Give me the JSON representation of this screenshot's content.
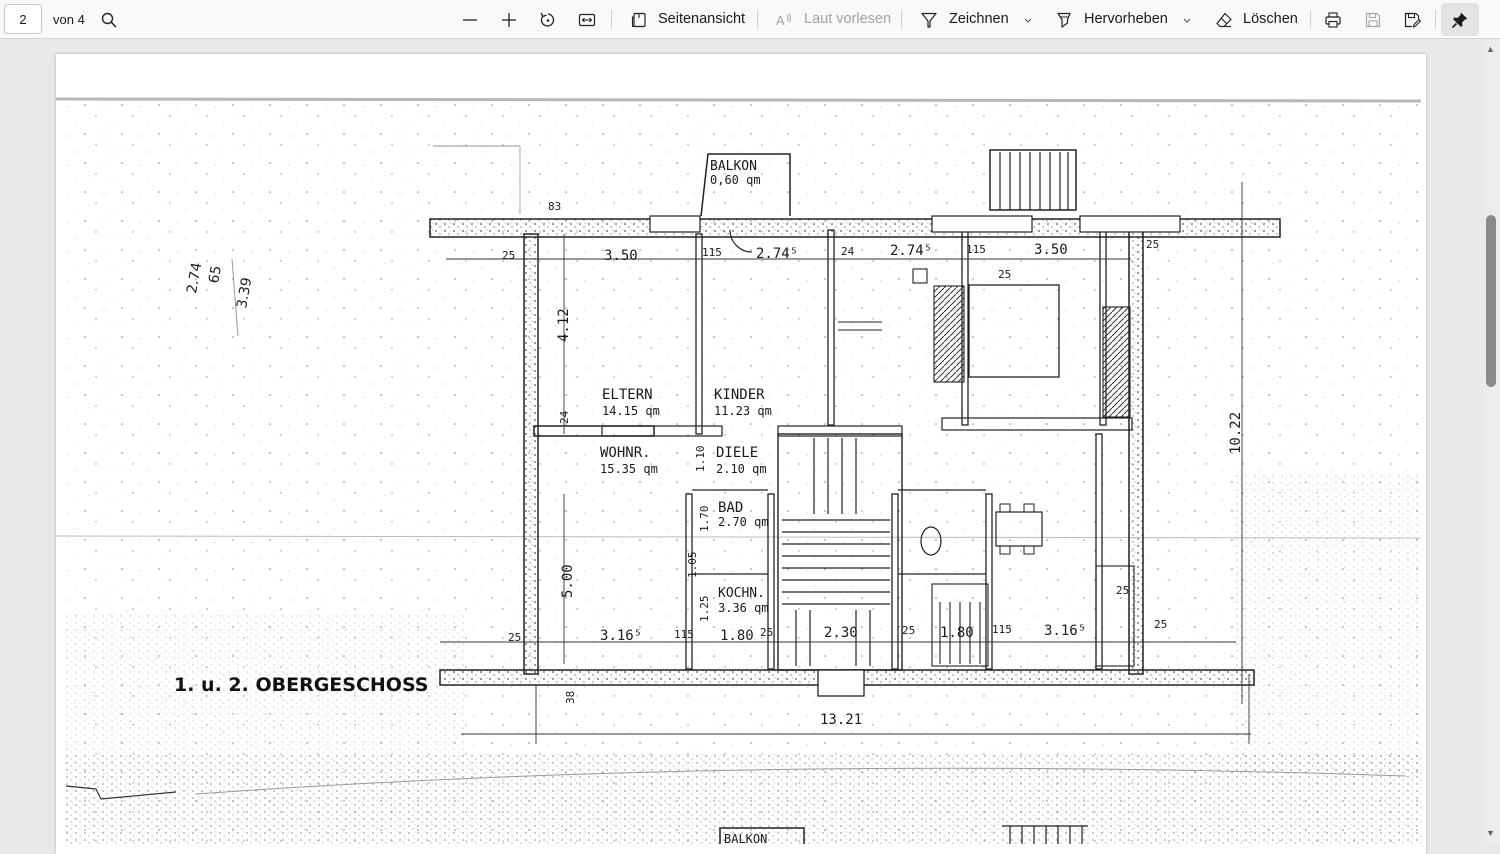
{
  "toolbar": {
    "page_number": "2",
    "page_total": "von 4",
    "page_view_label": "Seitenansicht",
    "read_aloud_label": "Laut vorlesen",
    "draw_label": "Zeichnen",
    "highlight_label": "Hervorheben",
    "erase_label": "Löschen"
  },
  "icons": {
    "search": "search-icon",
    "zoom_out": "minus-icon",
    "zoom_in": "plus-icon",
    "rotate": "rotate-icon",
    "fit": "fit-width-icon",
    "page_view": "page-view-icon",
    "read_aloud": "read-aloud-icon",
    "draw": "pen-icon",
    "highlight": "highlighter-icon",
    "erase": "eraser-icon",
    "print": "print-icon",
    "save": "save-icon",
    "save_as": "save-as-icon",
    "pin": "pin-icon"
  },
  "plan": {
    "title": "1. u. 2. OBERGESCHOSS",
    "balcony_top": "BALKON",
    "balcony_top_area": "0,60 qm",
    "balcony_bottom": "BALKON",
    "rooms": {
      "eltern": "ELTERN",
      "eltern_area": "14.15 qm",
      "kinder": "KINDER",
      "kinder_area": "11.23 qm",
      "wohnr": "WOHNR.",
      "wohnr_area": "15.35 qm",
      "diele": "DIELE",
      "diele_area": "2.10 qm",
      "bad": "BAD",
      "bad_area": "2.70 qm",
      "koch": "KOCHN.",
      "koch_area": "3.36 qm"
    },
    "dims": {
      "d350_left": "3.50",
      "d274": "2.74⁵",
      "d274b": "2.74⁵",
      "d350_right": "3.50",
      "d412": "4.12",
      "d1022": "10.22",
      "d500": "5.00",
      "d316_left": "3.16⁵",
      "d180_left": "1.80",
      "d230": "2.30",
      "d180_right": "1.80",
      "d316_right": "3.16⁵",
      "d1321": "13.21",
      "d25_a": "25",
      "d25_b": "25",
      "d25_c": "25",
      "d25_d": "25",
      "d25_e": "25",
      "d25_f": "25",
      "d25_g": "25",
      "d25_h": "25",
      "d115_a": "115",
      "d115_b": "115",
      "d115_c": "115",
      "d115_d": "115",
      "d24_a": "24",
      "d24_b": "24",
      "d38": "38",
      "d83": "83",
      "d110": "1.10",
      "d170": "1.70",
      "d125": "1.25",
      "d105": "1.05",
      "pencil_a": "2.74",
      "pencil_b": "65",
      "pencil_c": "3.39"
    }
  }
}
